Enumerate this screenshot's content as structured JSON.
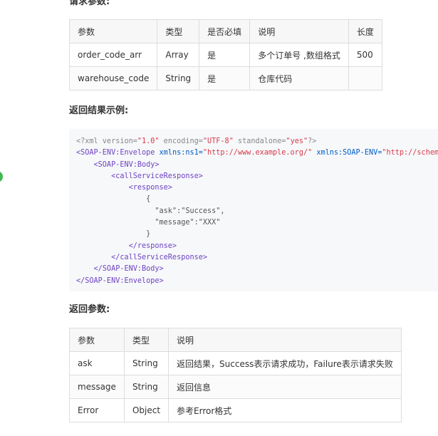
{
  "request_section": {
    "heading": "请求参数:",
    "columns": [
      "参数",
      "类型",
      "是否必填",
      "说明",
      "长度"
    ],
    "rows": [
      [
        "order_code_arr",
        "Array",
        "是",
        "多个订单号 ,数组格式",
        "500"
      ],
      [
        "warehouse_code",
        "String",
        "是",
        "仓库代码",
        ""
      ]
    ]
  },
  "example_section": {
    "heading": "返回结果示例:",
    "code_lines": {
      "l1_a": "<?xml version=",
      "l1_v1": "\"1.0\"",
      "l1_b": " encoding=",
      "l1_v2": "\"UTF-8\"",
      "l1_c": " standalone=",
      "l1_v3": "\"yes\"",
      "l1_d": "?>",
      "l2_tag": "<SOAP-ENV:Envelope",
      "l2_attr1": " xmlns:ns1=",
      "l2_v1": "\"http://www.example.org/\"",
      "l2_attr2": " xmlns:SOAP-ENV=",
      "l2_v2": "\"http://schem",
      "l3": "    <SOAP-ENV:Body>",
      "l4": "        <callServiceResponse>",
      "l5": "            <response>",
      "l6": "                {",
      "l7": "                  \"ask\":\"Success\",",
      "l8": "                  \"message\":\"XXX\"",
      "l9": "                }",
      "l10": "            </response>",
      "l11": "        </callServiceResponse>",
      "l12": "    </SOAP-ENV:Body>",
      "l13": "</SOAP-ENV:Envelope>"
    }
  },
  "return_section": {
    "heading": "返回参数:",
    "columns": [
      "参数",
      "类型",
      "说明"
    ],
    "rows": [
      [
        "ask",
        "String",
        "返回结果，Success表示请求成功，Failure表示请求失败"
      ],
      [
        "message",
        "String",
        "返回信息"
      ],
      [
        "Error",
        "Object",
        "参考Error格式"
      ]
    ]
  },
  "colors": {
    "accent_green": "#3fb950",
    "table_border": "#dddddd",
    "code_background": "#f6f8fa"
  }
}
